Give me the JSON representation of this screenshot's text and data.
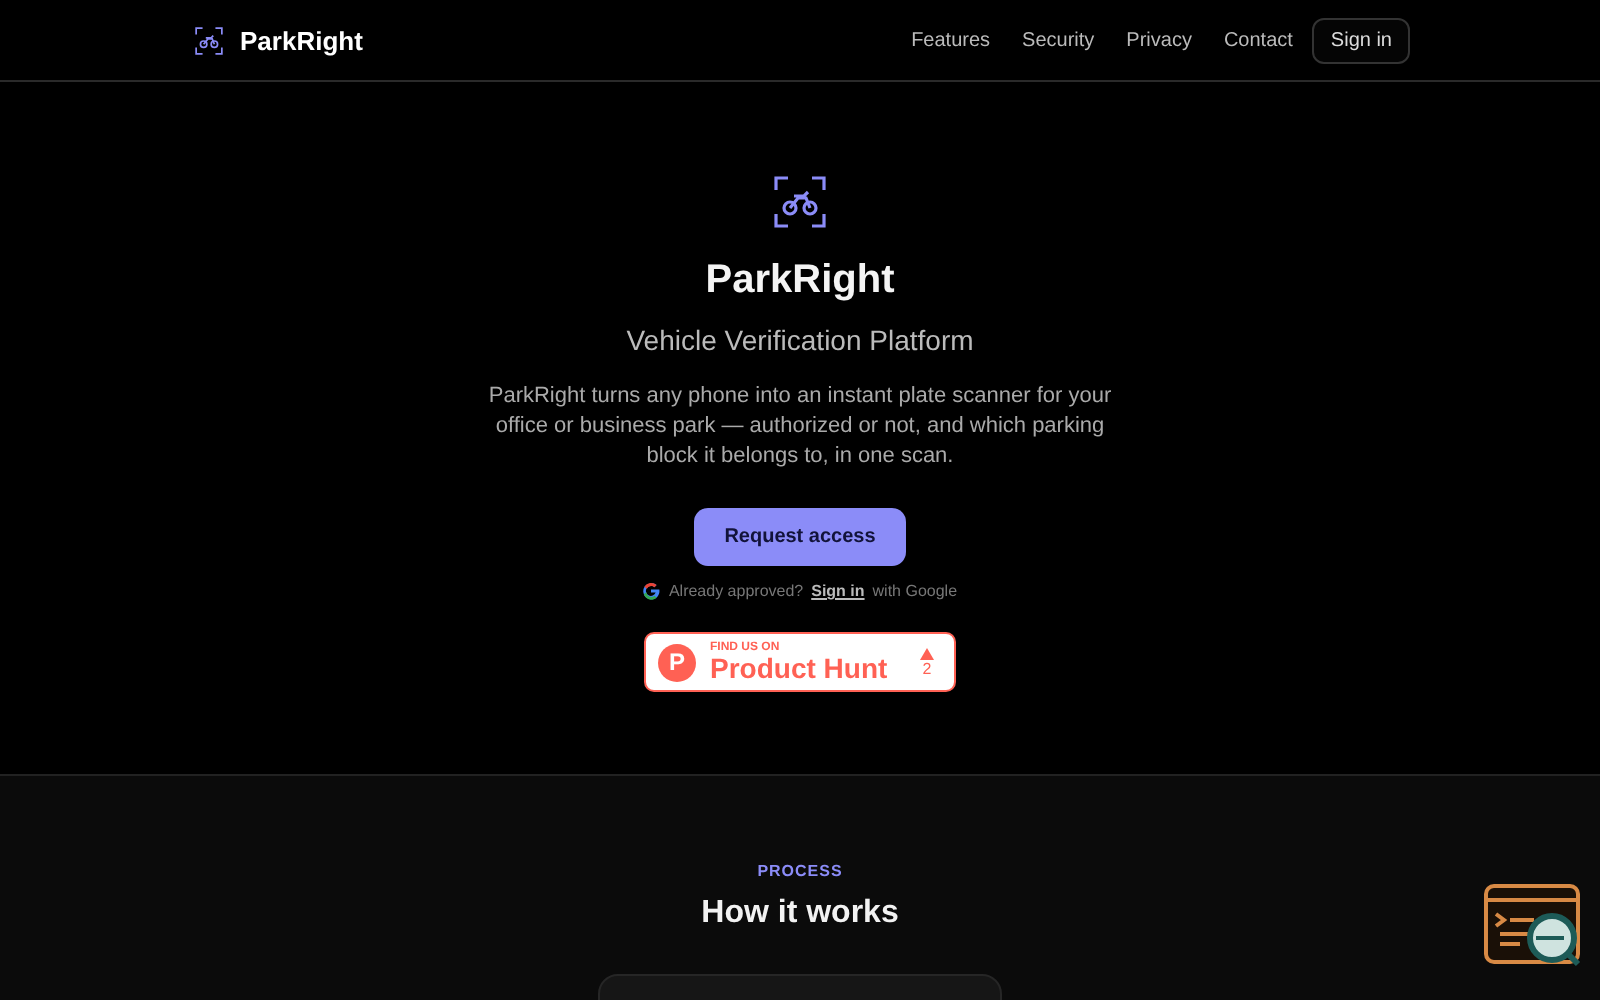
{
  "header": {
    "brand": "ParkRight",
    "links": [
      "Features",
      "Security",
      "Privacy",
      "Contact"
    ],
    "sign_in": "Sign in"
  },
  "hero": {
    "title": "ParkRight",
    "subtitle": "Vehicle Verification Platform",
    "description": "ParkRight turns any phone into an instant plate scanner for your office or business park — authorized or not, and which parking block it belongs to, in one scan.",
    "cta": "Request access",
    "google_prefix": "Already approved?",
    "google_link": "Sign in",
    "google_suffix": "with Google",
    "product_hunt": {
      "logo": "P",
      "kicker": "FIND US ON",
      "name": "Product Hunt",
      "votes": "2"
    }
  },
  "process": {
    "eyebrow": "PROCESS",
    "title": "How it works"
  }
}
